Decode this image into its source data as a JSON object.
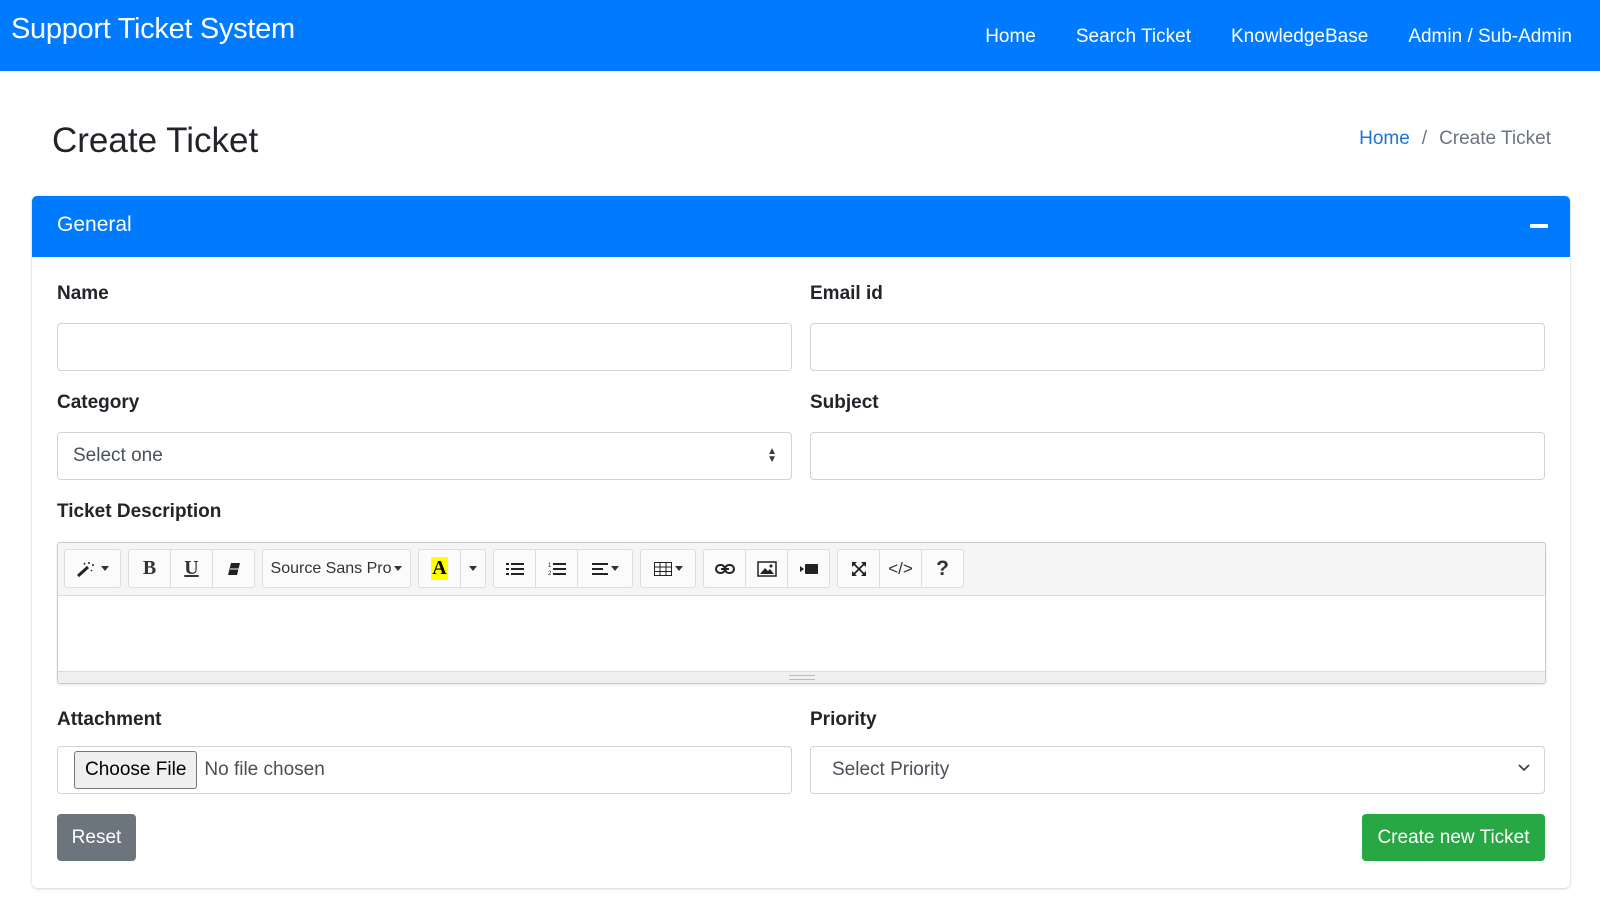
{
  "navbar": {
    "brand": "Support Ticket System",
    "links": [
      "Home",
      "Search Ticket",
      "KnowledgeBase",
      "Admin / Sub-Admin"
    ]
  },
  "page": {
    "title": "Create Ticket",
    "breadcrumb": {
      "home": "Home",
      "separator": "/",
      "current": "Create Ticket"
    }
  },
  "card": {
    "title": "General",
    "fields": {
      "name": {
        "label": "Name",
        "value": ""
      },
      "email": {
        "label": "Email id",
        "value": ""
      },
      "category": {
        "label": "Category",
        "selected": "Select one"
      },
      "subject": {
        "label": "Subject",
        "value": ""
      },
      "description": {
        "label": "Ticket Description",
        "value": ""
      },
      "attachment": {
        "label": "Attachment",
        "button": "Choose File",
        "status": "No file chosen"
      },
      "priority": {
        "label": "Priority",
        "selected": "Select Priority"
      }
    },
    "editor_toolbar": {
      "font_name": "Source Sans Pro",
      "bold": "B",
      "underline": "U",
      "highlight": "A",
      "code": "</>",
      "help": "?"
    },
    "buttons": {
      "reset": "Reset",
      "submit": "Create new Ticket"
    }
  },
  "colors": {
    "primary": "#007bff",
    "success": "#28a745",
    "secondary": "#6c757d"
  }
}
